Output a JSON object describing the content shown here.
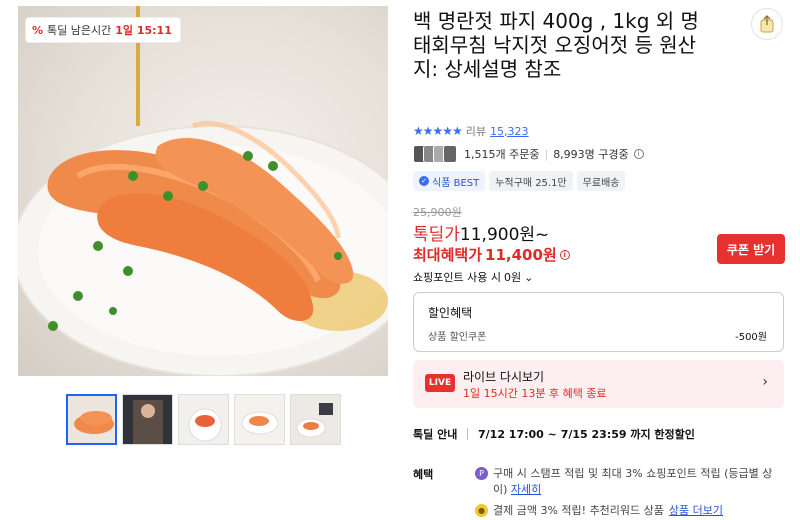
{
  "timer_badge": {
    "prefix": "톡딜 남은시간",
    "time": "1일 15:11"
  },
  "product": {
    "title": "백 명란젓 파지 400g , 1kg 외 명태회무침 낙지젓 오징어젓 등 원산지: 상세설명 참조",
    "rating_stars": 4.5,
    "review_label": "리뷰",
    "review_count": "15,323",
    "orders": "1,515개 주문중",
    "viewers": "8,993명 구경중"
  },
  "tags": [
    {
      "label": "식품 BEST",
      "icon": "best-badge-icon"
    },
    {
      "label": "누적구매 25.1만"
    },
    {
      "label": "무료배송"
    }
  ],
  "price": {
    "original": "25,900원",
    "deal_label": "톡딜가",
    "deal_value": "11,900원~",
    "max_label": "최대혜택가",
    "max_value": "11,400원",
    "coupon_button": "쿠폰 받기",
    "points_label": "쇼핑포인트 사용 시",
    "points_value": "0원"
  },
  "discount": {
    "heading": "할인혜택",
    "row_label": "상품 할인쿠폰",
    "row_value": "-500원"
  },
  "live": {
    "badge": "LIVE",
    "title": "라이브 다시보기",
    "subtitle": "1일 15시간 13분 후 혜택 종료"
  },
  "deal_info": {
    "label": "톡딜 안내",
    "value": "7/12 17:00 ~ 7/15 23:59 까지 한정할인"
  },
  "benefits": {
    "label": "혜택",
    "row1_text": "구매 시 스탬프 적립 및 최대 3% 쇼핑포인트 적립 (등급별 상이)",
    "row1_link": "자세히",
    "row2_text": "결제 금액 3% 적립! 추천리워드 상품",
    "row2_link": "상품 더보기"
  },
  "thumbnails": [
    "roe-closeup",
    "person-photo",
    "roe-bowl",
    "roe-plate",
    "roe-table"
  ],
  "colors": {
    "accent_red": "#e6312f",
    "accent_blue": "#3b6cf6",
    "live_bg": "#fdeef0"
  }
}
